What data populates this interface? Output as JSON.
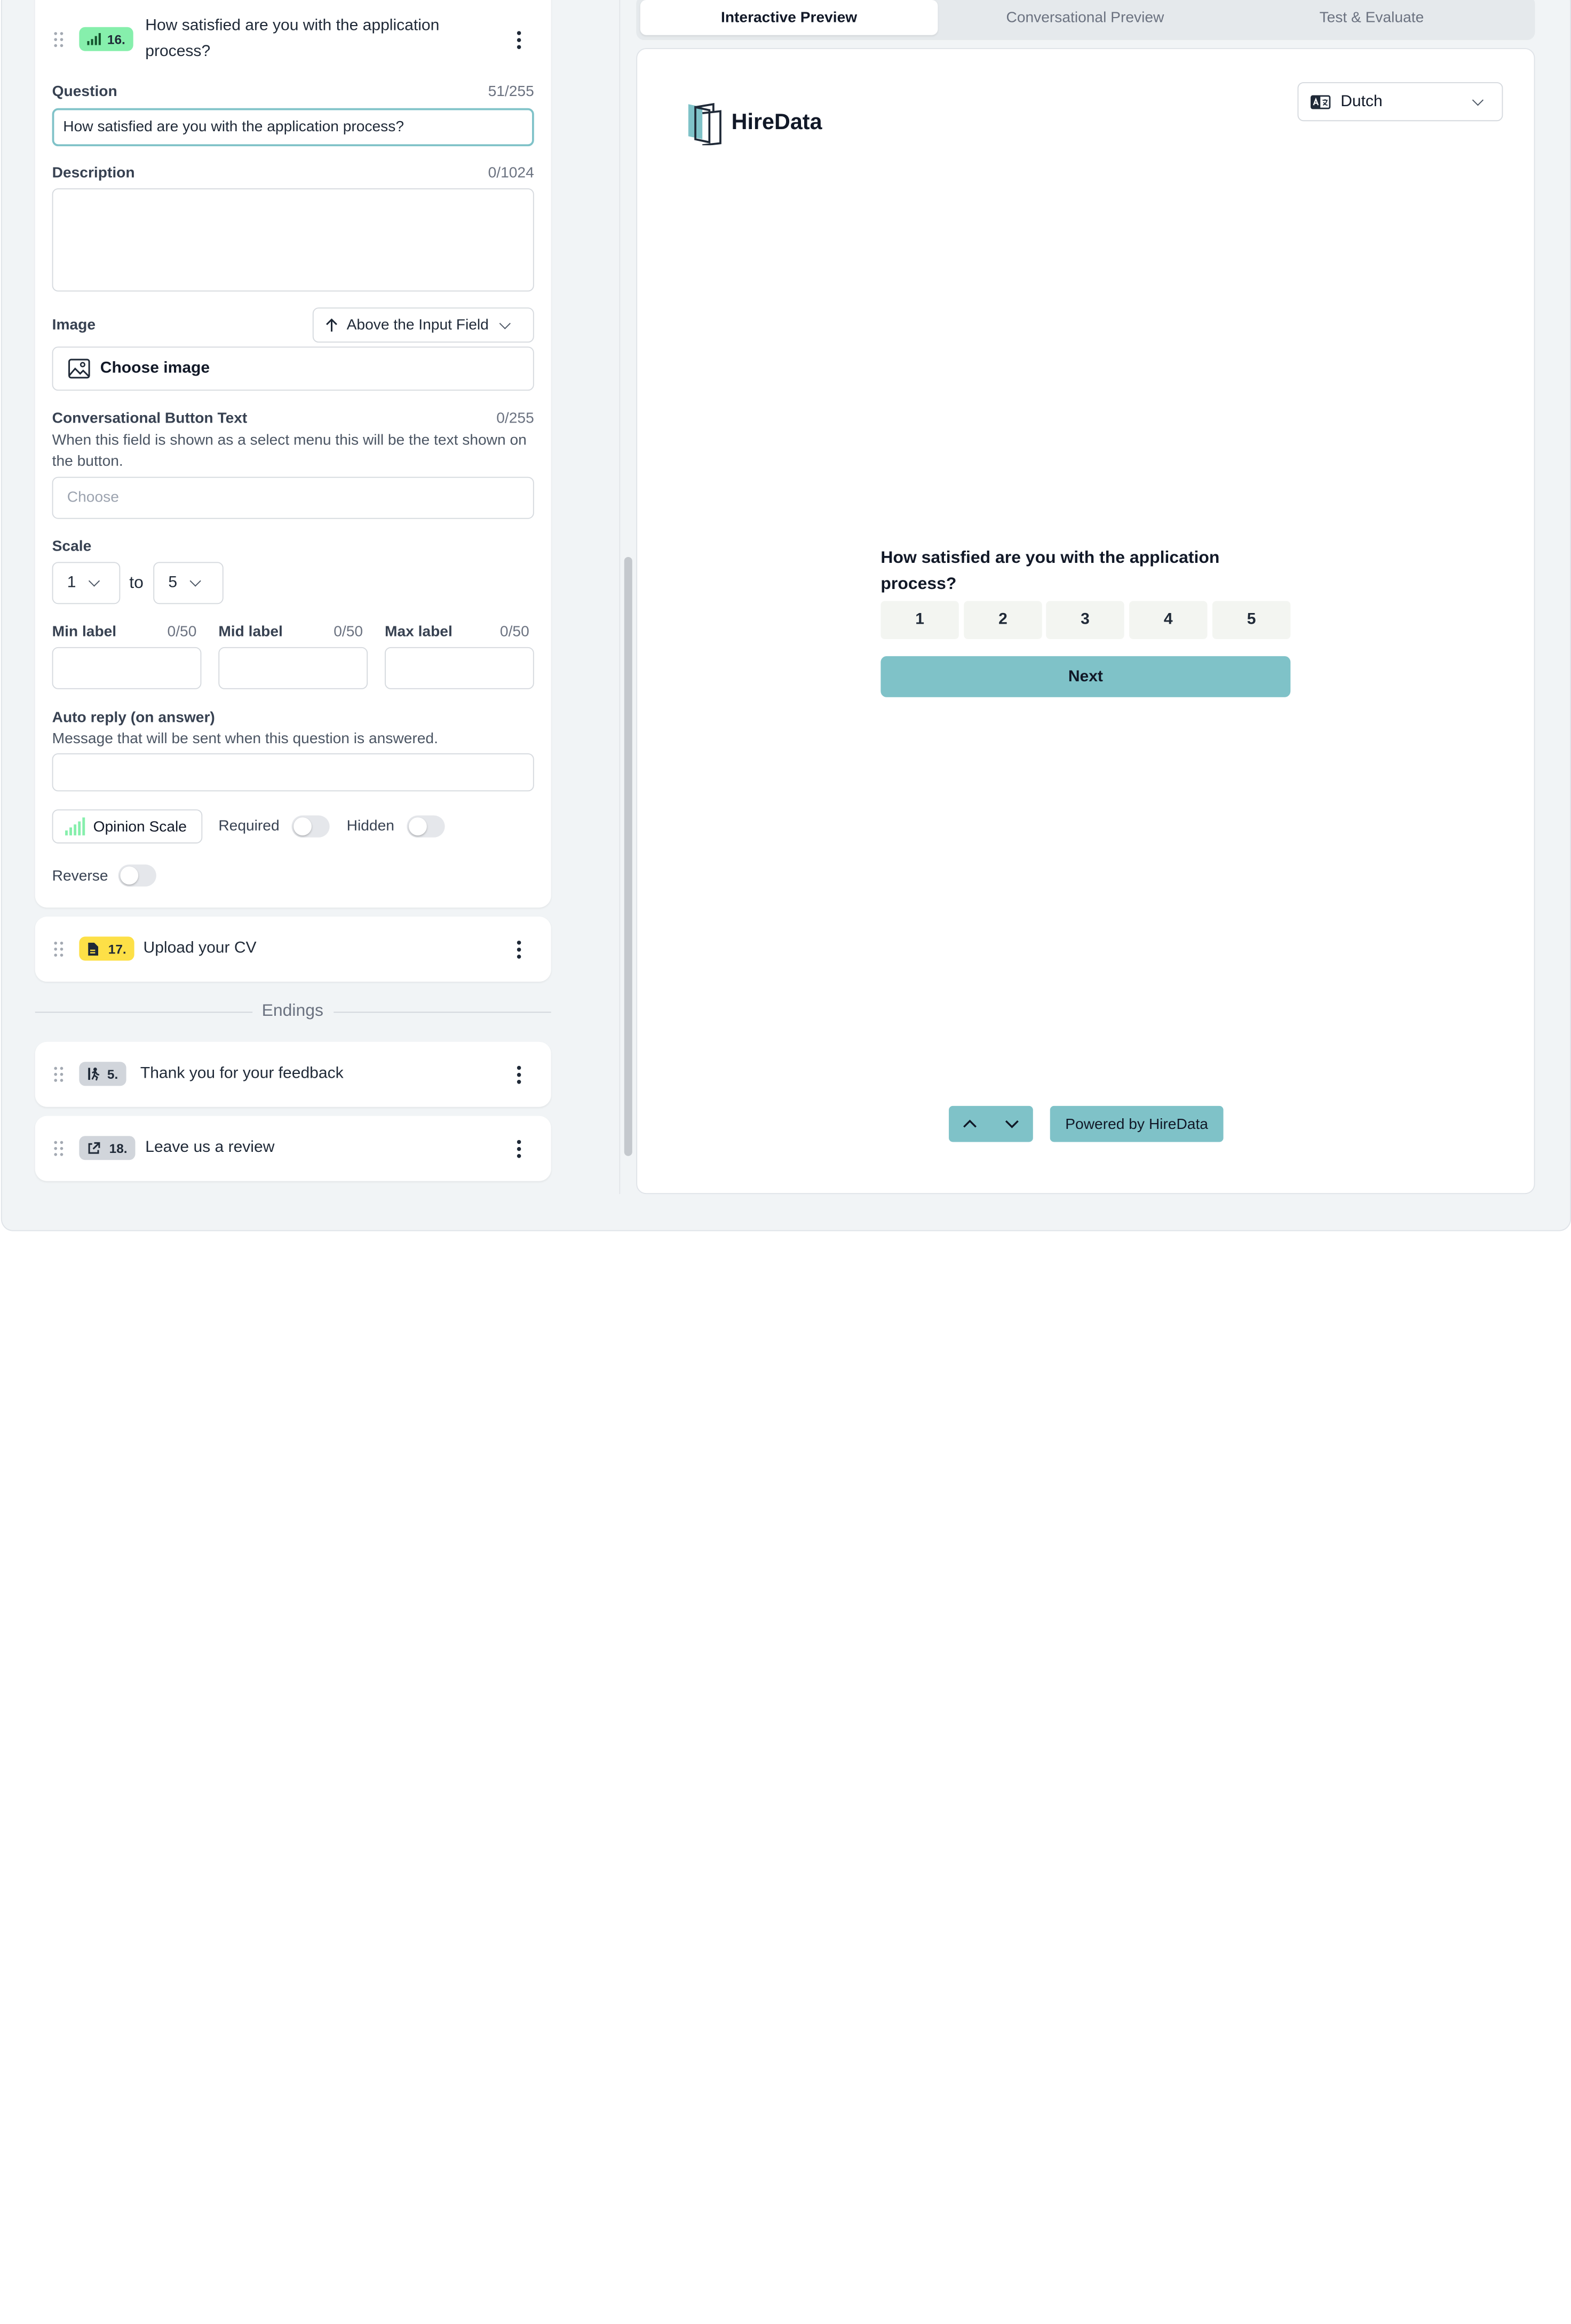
{
  "left": {
    "question_card": {
      "number": "16.",
      "title": "How satisfied are you with the application process?",
      "question_label": "Question",
      "question_count": "51/255",
      "question_value": "How satisfied are you with the application process?",
      "description_label": "Description",
      "description_count": "0/1024",
      "image_label": "Image",
      "image_position": "Above the Input Field",
      "choose_image": "Choose image",
      "conv_label": "Conversational Button Text",
      "conv_count": "0/255",
      "conv_hint": "When this field is shown as a select menu this will be the text shown on the button.",
      "conv_placeholder": "Choose",
      "scale_label": "Scale",
      "scale_from": "1",
      "scale_to_word": "to",
      "scale_to": "5",
      "min_label": "Min label",
      "min_count": "0/50",
      "mid_label": "Mid label",
      "mid_count": "0/50",
      "max_label": "Max label",
      "max_count": "0/50",
      "auto_reply_label": "Auto reply (on answer)",
      "auto_reply_hint": "Message that will be sent when this question is answered.",
      "type_label": "Opinion Scale",
      "required_label": "Required",
      "hidden_label": "Hidden",
      "reverse_label": "Reverse"
    },
    "cards": [
      {
        "number": "17.",
        "title": "Upload your CV"
      }
    ],
    "endings_label": "Endings",
    "endings": [
      {
        "number": "5.",
        "title": "Thank you for your feedback"
      },
      {
        "number": "18.",
        "title": "Leave us a review"
      }
    ]
  },
  "right": {
    "tabs": [
      {
        "label": "Interactive Preview"
      },
      {
        "label": "Conversational Preview"
      },
      {
        "label": "Test & Evaluate"
      }
    ],
    "brand": "HireData",
    "language": "Dutch",
    "question": "How satisfied are you with the application process?",
    "scale": [
      "1",
      "2",
      "3",
      "4",
      "5"
    ],
    "next": "Next",
    "powered_by": "Powered by HireData"
  },
  "colors": {
    "accent": "#7fc2c8",
    "badge_green": "#86efac",
    "badge_yellow": "#fde047",
    "badge_gray": "#d1d5db",
    "scale_bg": "#f3f5f1"
  }
}
